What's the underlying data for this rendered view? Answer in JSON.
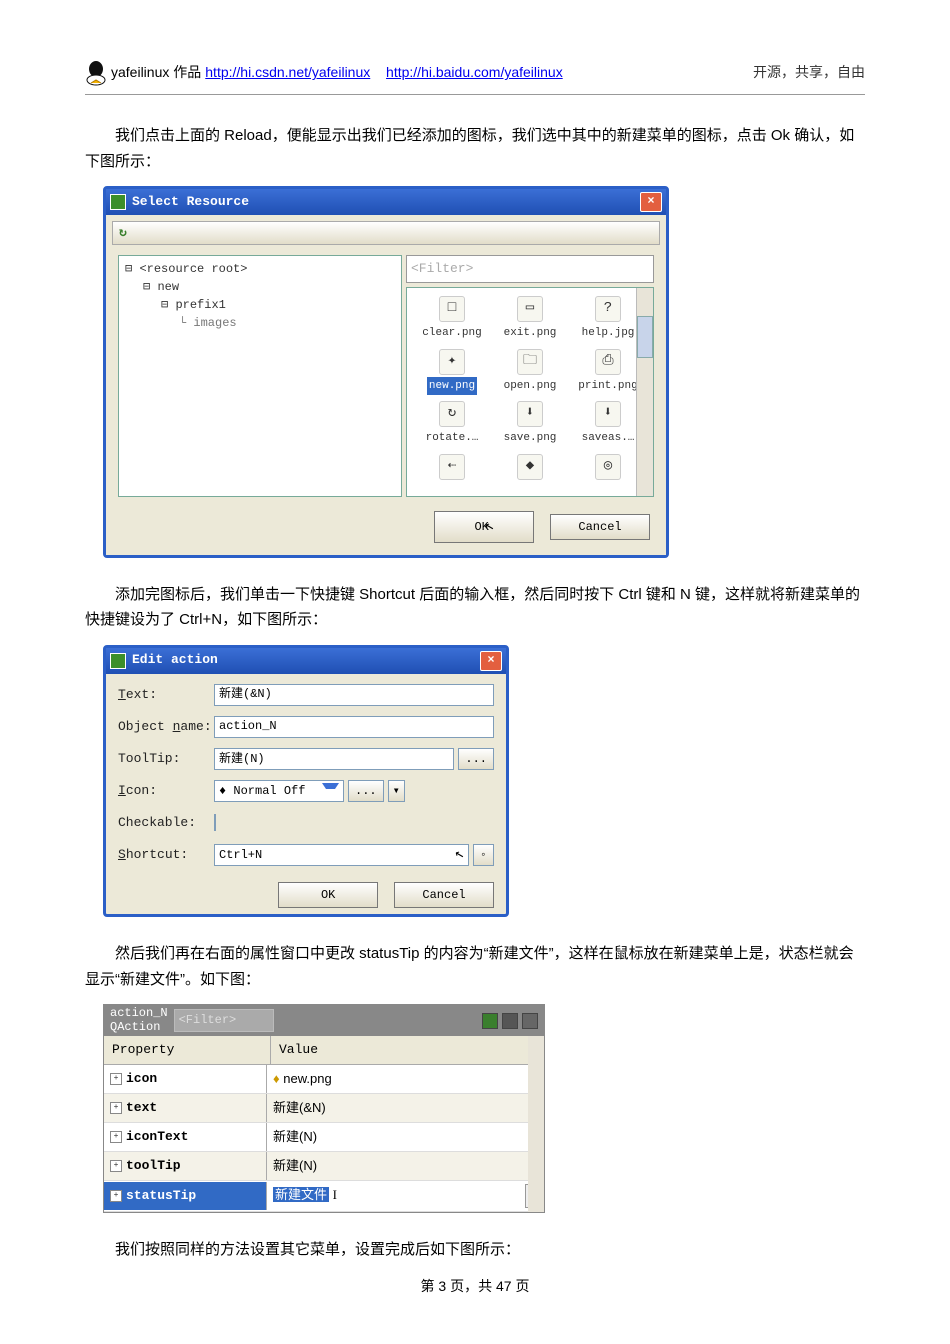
{
  "header": {
    "author": "yafeilinux 作品",
    "link1_text": "http://hi.csdn.net/yafeilinux",
    "link2_text": "http://hi.baidu.com/yafeilinux",
    "slogan": "开源，共享，自由"
  },
  "para1": "我们点击上面的 Reload，便能显示出我们已经添加的图标，我们选中其中的新建菜单的图标，点击 Ok 确认，如下图所示：",
  "select_resource": {
    "title": "Select Resource",
    "filter_placeholder": "<Filter>",
    "tree": {
      "root": "<resource root>",
      "n1": "new",
      "n2": "prefix1",
      "n3": "images"
    },
    "items": [
      {
        "label": "clear.png",
        "glyph": "□"
      },
      {
        "label": "exit.png",
        "glyph": "▭"
      },
      {
        "label": "help.jpg",
        "glyph": "?"
      },
      {
        "label": "new.png",
        "glyph": "✦",
        "selected": true
      },
      {
        "label": "open.png",
        "glyph": "🗀"
      },
      {
        "label": "print.png",
        "glyph": "⎙"
      },
      {
        "label": "rotate.…",
        "glyph": "↻"
      },
      {
        "label": "save.png",
        "glyph": "⬇"
      },
      {
        "label": "saveas.…",
        "glyph": "⬇"
      },
      {
        "label": "",
        "glyph": "⇠"
      },
      {
        "label": "",
        "glyph": "◆"
      },
      {
        "label": "",
        "glyph": "◎"
      }
    ],
    "ok": "OK",
    "cancel": "Cancel"
  },
  "para2": "添加完图标后，我们单击一下快捷键 Shortcut 后面的输入框，然后同时按下 Ctrl 键和 N 键，这样就将新建菜单的快捷键设为了 Ctrl+N，如下图所示：",
  "edit_action": {
    "title": "Edit action",
    "text_label": "Text:",
    "text_value": "新建(&N)",
    "objname_label_pre": "Object ",
    "objname_label_u": "n",
    "objname_label_post": "ame:",
    "objname_value": "action_N",
    "tooltip_label": "ToolTip:",
    "tooltip_value": "新建(N)",
    "tooltip_more": "...",
    "icon_label_u": "I",
    "icon_label_post": "con:",
    "icon_value": "Normal Off",
    "icon_more": "...",
    "checkable_label": "Checkable:",
    "shortcut_label_u": "S",
    "shortcut_label_post": "hortcut:",
    "shortcut_value": "Ctrl+N",
    "ok": "OK",
    "cancel": "Cancel"
  },
  "para3": "然后我们再在右面的属性窗口中更改 statusTip 的内容为“新建文件”，这样在鼠标放在新建菜单上是，状态栏就会显示“新建文件”。如下图：",
  "prop_table": {
    "obj_line1": "action_N",
    "obj_line2": "QAction",
    "filter_placeholder": "<Filter>",
    "col_prop": "Property",
    "col_val": "Value",
    "rows": [
      {
        "prop": "icon",
        "val": "new.png",
        "icon": true
      },
      {
        "prop": "text",
        "val": "新建(&N)"
      },
      {
        "prop": "iconText",
        "val": "新建(N)"
      },
      {
        "prop": "toolTip",
        "val": "新建(N)"
      },
      {
        "prop": "statusTip",
        "val": "新建文件",
        "editing": true
      }
    ]
  },
  "para4": "我们按照同样的方法设置其它菜单，设置完成后如下图所示：",
  "footer": "第 3 页，共 47 页"
}
